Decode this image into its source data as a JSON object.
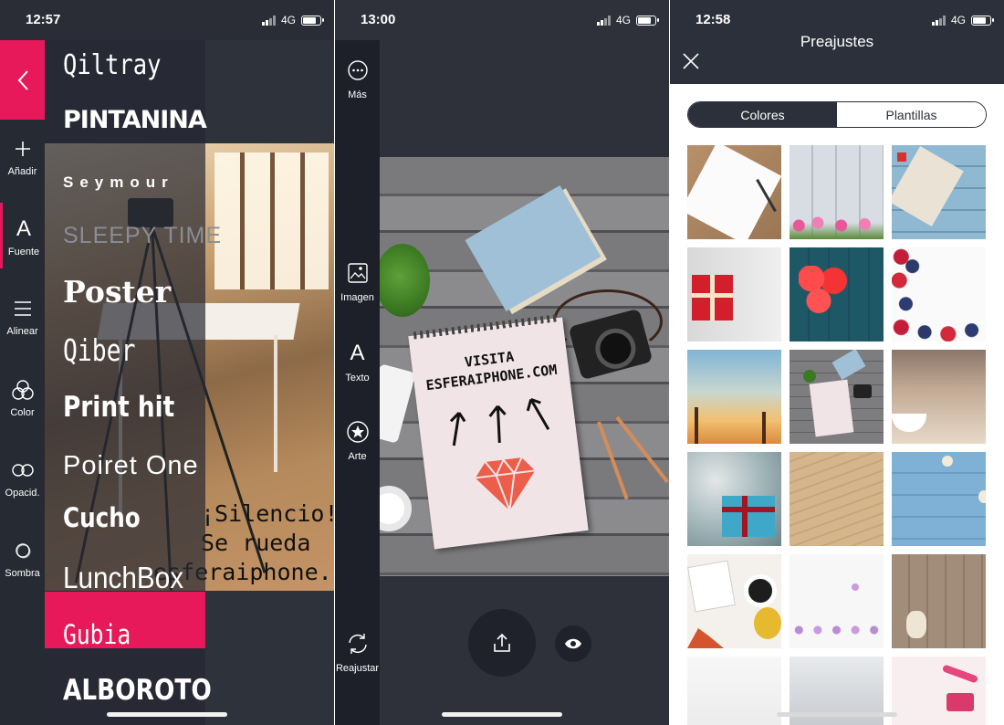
{
  "screens": [
    {
      "status": {
        "time": "12:57",
        "network": "4G"
      },
      "tools": [
        {
          "label": "Añadir",
          "icon": "plus-icon"
        },
        {
          "label": "Fuente",
          "icon": "font-icon",
          "active": true
        },
        {
          "label": "Alinear",
          "icon": "align-icon"
        },
        {
          "label": "Color",
          "icon": "color-icon"
        },
        {
          "label": "Opacid.",
          "icon": "opacity-icon"
        },
        {
          "label": "Sombra",
          "icon": "shadow-icon"
        }
      ],
      "fonts": [
        "Qiltray",
        "PINTANINA",
        "Seymour",
        "SLEEPY TIME",
        "Poster",
        "Qiber",
        "Print hit",
        "Poiret One",
        "Cucho",
        "LunchBox",
        "Gubia",
        "ALBOROTO"
      ],
      "selected_font": "LunchBox",
      "canvas_text": [
        "¡Silencio!",
        "Se rueda",
        "esferaiphone.com"
      ]
    },
    {
      "status": {
        "time": "13:00",
        "network": "4G"
      },
      "tools": [
        {
          "label": "Más",
          "icon": "more-icon"
        },
        {
          "label": "Imagen",
          "icon": "image-icon"
        },
        {
          "label": "Texto",
          "icon": "text-icon"
        },
        {
          "label": "Arte",
          "icon": "art-icon"
        },
        {
          "label": "Reajustar",
          "icon": "resize-icon"
        }
      ],
      "canvas_text": [
        "VISITA",
        "ESFERAIPHONE.COM"
      ]
    },
    {
      "status": {
        "time": "12:58",
        "network": "4G"
      },
      "title": "Preajustes",
      "tabs": [
        {
          "label": "Colores",
          "active": false
        },
        {
          "label": "Plantillas",
          "active": true
        }
      ],
      "templates": [
        "paper-pencil",
        "white-wood-flowers",
        "blue-wood-paper",
        "red-gift-box",
        "red-hearts-teal",
        "berries-white",
        "sunset-palms",
        "desk-notebook",
        "bokeh-cup",
        "blue-gift-bokeh",
        "sand",
        "blue-wood-shells",
        "autumn-coffee",
        "purple-flowers",
        "guitar-wood",
        "white-shells",
        "bowl",
        "pink-makeup"
      ]
    }
  ]
}
